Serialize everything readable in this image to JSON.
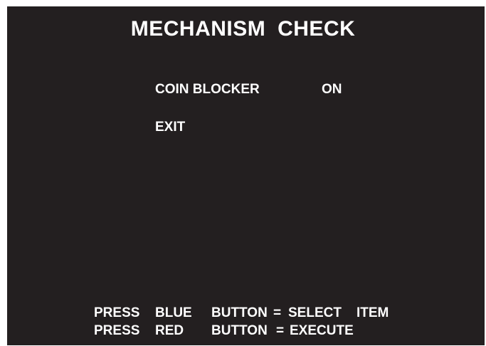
{
  "screen": {
    "title": "MECHANISM  CHECK",
    "menu": {
      "coin_blocker_label": "COIN BLOCKER",
      "coin_blocker_value": "ON",
      "exit_label": "EXIT"
    },
    "instructions": [
      {
        "press": "PRESS",
        "color": "BLUE",
        "button": "BUTTON",
        "eq": "=",
        "action1": "SELECT",
        "action2": "ITEM"
      },
      {
        "press": "PRESS",
        "color": "RED",
        "button": "BUTTON",
        "eq": "=",
        "action1": "EXECUTE",
        "action2": ""
      }
    ]
  },
  "colors": {
    "background": "#231f20",
    "text": "#ffffff",
    "border": "#ffffff"
  }
}
